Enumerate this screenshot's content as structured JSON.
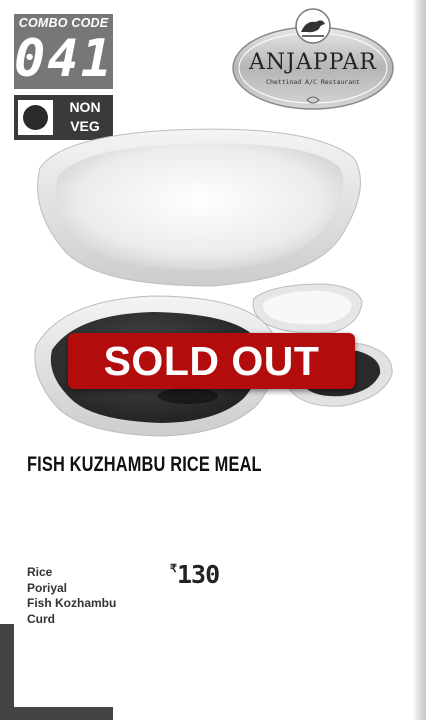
{
  "combo": {
    "label": "COMBO CODE",
    "code": "041"
  },
  "diet_badge": {
    "line1": "NON",
    "line2": "VEG"
  },
  "logo": {
    "name": "ANJAPPAR",
    "subtitle": "Chettinad A/C Restaurant"
  },
  "status": {
    "label": "SOLD OUT"
  },
  "meal": {
    "name": "FISH KUZHAMBU RICE MEAL",
    "items": [
      "Rice",
      "Poriyal",
      "Fish Kozhambu",
      "Curd"
    ],
    "currency": "₹",
    "price": "130"
  }
}
